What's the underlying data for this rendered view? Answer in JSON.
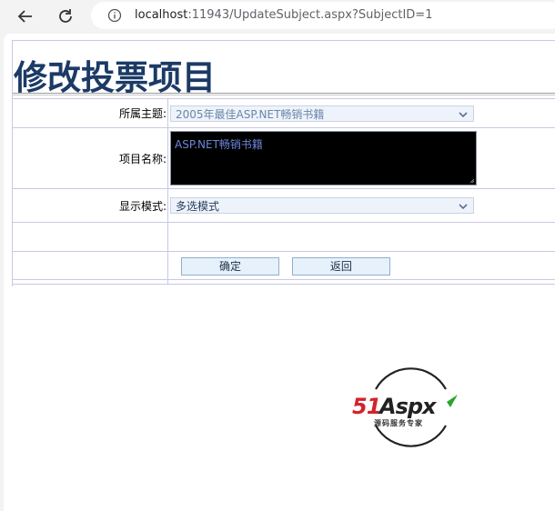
{
  "browser": {
    "url_host": "localhost",
    "url_rest": ":11943/UpdateSubject.aspx?SubjectID=1"
  },
  "page": {
    "title": "修改投票项目"
  },
  "form": {
    "subject": {
      "label": "所属主题:",
      "selected": "2005年最佳ASP.NET畅销书籍"
    },
    "item_name": {
      "label": "项目名称:",
      "value": "ASP.NET畅销书籍"
    },
    "display_mode": {
      "label": "显示模式:",
      "selected": "多选模式"
    },
    "confirm_label": "确定",
    "back_label": "返回"
  },
  "logo": {
    "brand_51": "51",
    "brand_aspx": "Aspx",
    "tagline": "源码服务专家"
  },
  "colors": {
    "title": "#1b3a66",
    "textarea_bg": "#000000",
    "logo_red": "#d3232a",
    "logo_green": "#2aa52a"
  }
}
